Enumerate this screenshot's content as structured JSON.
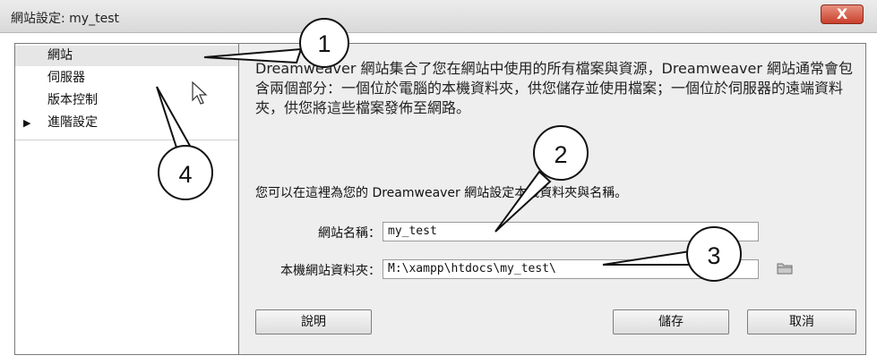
{
  "window": {
    "title": "網站設定: my_test",
    "close_label": "X"
  },
  "sidebar": {
    "items": [
      {
        "label": "網站",
        "selected": true
      },
      {
        "label": "伺服器"
      },
      {
        "label": "版本控制"
      },
      {
        "label": "進階設定",
        "expander": "▶"
      }
    ]
  },
  "main": {
    "description": "Dreamweaver 網站集合了您在網站中使用的所有檔案與資源，Dreamweaver 網站通常會包含兩個部分：一個位於電腦的本機資料夾，供您儲存並使用檔案；一個位於伺服器的遠端資料夾，供您將這些檔案發佈至網路。",
    "intro": "您可以在這裡為您的 Dreamweaver 網站設定本機資料夾與名稱。",
    "site_name_label": "網站名稱：",
    "site_name_value": "my_test",
    "local_folder_label": "本機網站資料夾：",
    "local_folder_value": "M:\\xampp\\htdocs\\my_test\\",
    "folder_icon": "folder-icon"
  },
  "buttons": {
    "help": "說明",
    "save": "儲存",
    "cancel": "取消"
  },
  "annotations": {
    "callouts": [
      "1",
      "2",
      "3",
      "4"
    ]
  }
}
